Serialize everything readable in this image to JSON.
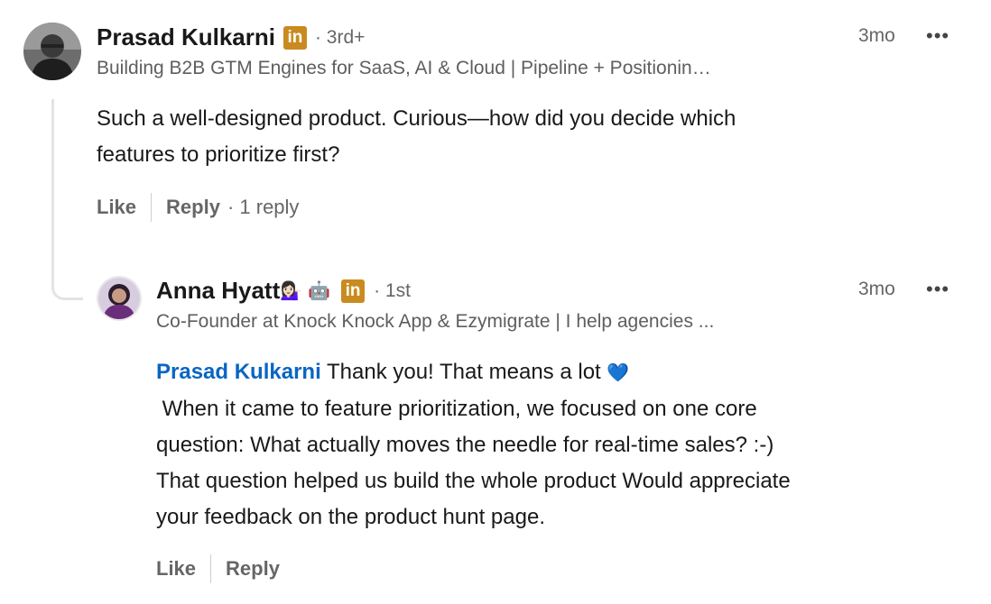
{
  "comment": {
    "author": {
      "name": "Prasad Kulkarni",
      "badge": "in",
      "degree": "· 3rd+",
      "headline": "Building B2B GTM Engines for SaaS, AI & Cloud | Pipeline + Positionin…"
    },
    "time": "3mo",
    "more_icon": "•••",
    "text_line1": "Such a well-designed product. Curious—how did you decide which",
    "text_line2": "features to prioritize first?",
    "actions": {
      "like": "Like",
      "reply": "Reply",
      "reply_count": "· 1 reply"
    }
  },
  "reply": {
    "author": {
      "name": "Anna Hyatt",
      "emoji1": "💁🏻‍♀️",
      "emoji2": "🤖",
      "badge": "in",
      "degree": "· 1st",
      "headline": "Co-Founder at Knock Knock App & Ezymigrate | I help agencies ..."
    },
    "time": "3mo",
    "more_icon": "•••",
    "mention": "Prasad Kulkarni",
    "line1_rest": " Thank you! That means a lot ",
    "heart": "💙",
    "line2": " When it came to feature prioritization, we focused on one core",
    "line3": "question: What actually moves the needle for real-time sales? :-)",
    "line4": "That question helped us build the whole product Would appreciate",
    "line5": "your feedback on the product hunt page.",
    "actions": {
      "like": "Like",
      "reply": "Reply"
    }
  },
  "colors": {
    "mention": "#0a66c2",
    "linkedin_badge": "#c98b1f",
    "thread_line": "#e3e3e3"
  }
}
